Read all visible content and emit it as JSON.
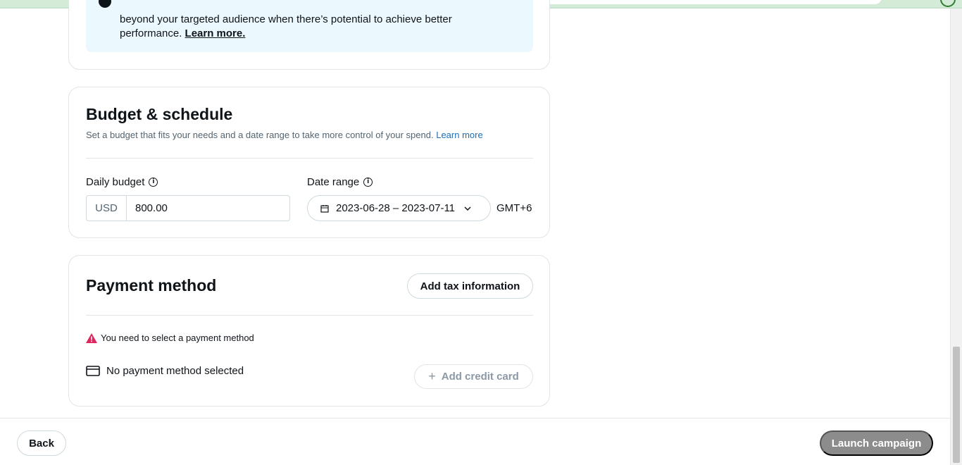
{
  "targeting_notice": {
    "text": "beyond your targeted audience when there’s potential to achieve better performance.",
    "learn_more": "Learn more."
  },
  "budget_section": {
    "title": "Budget & schedule",
    "subtitle": "Set a budget that fits your needs and a date range to take more control of your spend.",
    "learn_more": "Learn more",
    "daily_budget_label": "Daily budget",
    "currency": "USD",
    "daily_budget_value": "800.00",
    "date_range_label": "Date range",
    "date_range_value": "2023-06-28 – 2023-07-11",
    "timezone": "GMT+6"
  },
  "payment_section": {
    "title": "Payment method",
    "add_tax_label": "Add tax information",
    "warning": "You need to select a payment method",
    "no_payment": "No payment method selected",
    "add_card_label": "Add credit card"
  },
  "footer": {
    "back_label": "Back",
    "launch_label": "Launch campaign"
  },
  "colors": {
    "info_bg": "#ebf8fd",
    "link": "#1d6fb8",
    "warning": "#e0245e",
    "launch_disabled": "#8c8c8c"
  },
  "icons": {
    "info": "info-icon",
    "calendar": "calendar-icon",
    "chevron": "chevron-down-icon",
    "warning": "warning-icon",
    "card": "credit-card-icon",
    "plus": "plus-icon"
  }
}
